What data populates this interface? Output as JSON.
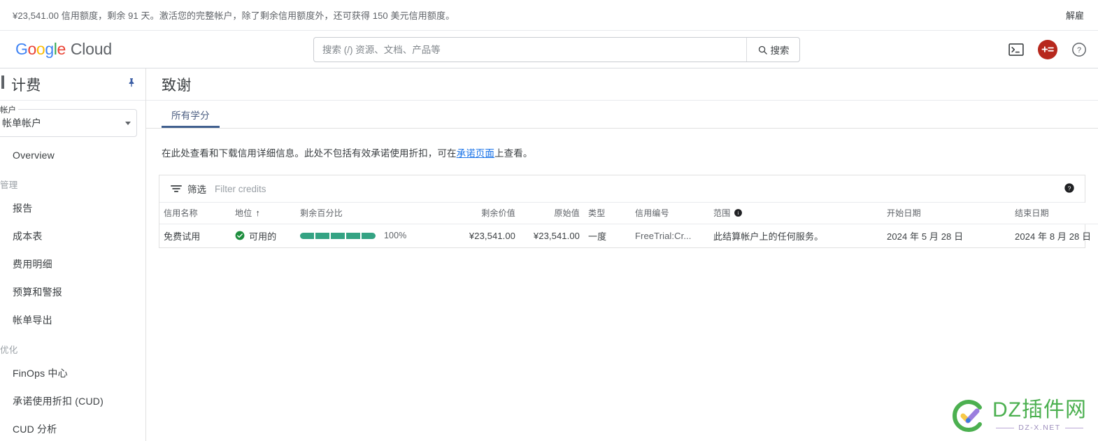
{
  "promo": {
    "message": "¥23,541.00 信用额度，剩余 91 天。激活您的完整帐户，除了剩余信用额度外，还可获得 150 美元信用额度。",
    "action_label": "解雇"
  },
  "appbar": {
    "logo_google": "Google",
    "logo_cloud": "Cloud",
    "search_placeholder": "搜索 (/) 资源、文档、产品等",
    "search_value": "",
    "search_button_label": "搜索",
    "icons": {
      "cloud_shell": "terminal-icon",
      "avatar": "account-avatar",
      "help": "help-circle-icon"
    }
  },
  "sidebar": {
    "title": "计费",
    "pin_icon": "pin-icon",
    "account_picker": {
      "label": "帐户",
      "value": "帐单帐户"
    },
    "items": [
      {
        "label": "Overview",
        "type": "item"
      },
      {
        "label": "管理",
        "type": "section"
      },
      {
        "label": "报告",
        "type": "item"
      },
      {
        "label": "成本表",
        "type": "item"
      },
      {
        "label": "费用明细",
        "type": "item"
      },
      {
        "label": "预算和警报",
        "type": "item"
      },
      {
        "label": "帐单导出",
        "type": "item"
      },
      {
        "label": "优化",
        "type": "section"
      },
      {
        "label": "FinOps 中心",
        "type": "item"
      },
      {
        "label": "承诺使用折扣 (CUD)",
        "type": "item"
      },
      {
        "label": "CUD 分析",
        "type": "item"
      }
    ]
  },
  "main": {
    "page_title": "致谢",
    "tabs": [
      {
        "label": "所有学分",
        "active": true
      }
    ],
    "description_prefix": "在此处查看和下载信用详细信息。此处不包括有效承诺使用折扣，可在",
    "description_link": "承诺页面",
    "description_suffix": "上查看。",
    "filter": {
      "icon": "filter-icon",
      "label": "筛选",
      "placeholder": "Filter credits",
      "value": "",
      "help_icon": "help-filled-icon"
    },
    "table": {
      "columns": [
        {
          "key": "name",
          "label": "信用名称",
          "align": "left"
        },
        {
          "key": "status",
          "label": "地位",
          "align": "left",
          "sort": "↑"
        },
        {
          "key": "percent",
          "label": "剩余百分比",
          "align": "left"
        },
        {
          "key": "remaining_value",
          "label": "剩余价值",
          "align": "right"
        },
        {
          "key": "original_value",
          "label": "原始值",
          "align": "right"
        },
        {
          "key": "type",
          "label": "类型",
          "align": "left"
        },
        {
          "key": "credit_id",
          "label": "信用编号",
          "align": "left"
        },
        {
          "key": "scope",
          "label": "范围",
          "align": "left",
          "info": true
        },
        {
          "key": "start_date",
          "label": "开始日期",
          "align": "left"
        },
        {
          "key": "end_date",
          "label": "结束日期",
          "align": "left"
        }
      ],
      "rows": [
        {
          "name": "免费试用",
          "status": "可用的",
          "status_icon": "check-circle-icon",
          "percent_label": "100%",
          "percent_value": 100,
          "segments_total": 5,
          "segments_filled": 5,
          "remaining_value": "¥23,541.00",
          "original_value": "¥23,541.00",
          "type": "一度",
          "credit_id": "FreeTrial:Cr...",
          "scope": "此结算帐户上的任何服务。",
          "start_date": "2024 年 5 月 28 日",
          "end_date": "2024 年 8 月 28 日",
          "expand_icon": "chevron-down-icon"
        }
      ]
    }
  },
  "watermark": {
    "main_text": "DZ插件网",
    "sub_text": "DZ-X.NET"
  },
  "colors": {
    "accent_blue": "#1a73e8",
    "tab_underline": "#41608f",
    "progress_green": "#34a383",
    "status_green": "#1e8e3e",
    "avatar_red": "#b7281d",
    "watermark_green": "#4cb050"
  }
}
